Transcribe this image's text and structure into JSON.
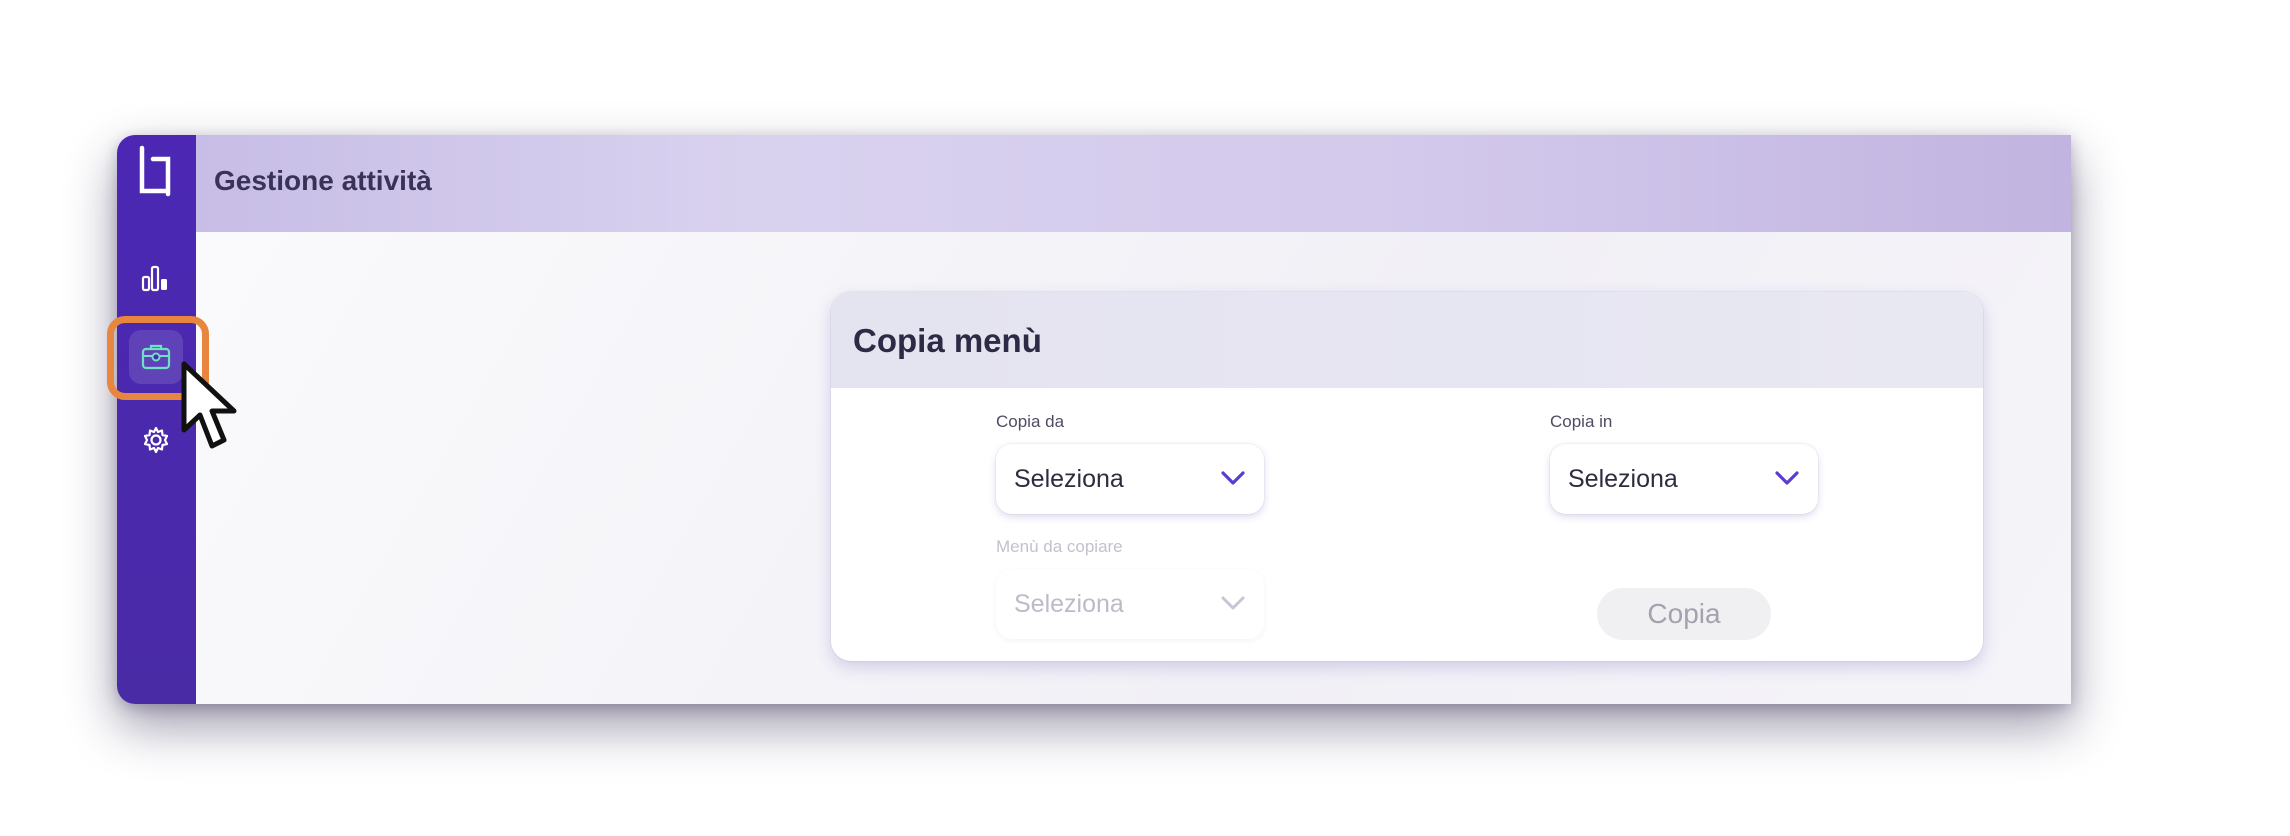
{
  "header": {
    "title": "Gestione attività"
  },
  "sidebar": {
    "items": [
      {
        "icon": "bar-chart-icon",
        "active": false
      },
      {
        "icon": "briefcase-icon",
        "active": true
      },
      {
        "icon": "gear-icon",
        "active": false
      }
    ]
  },
  "card": {
    "title": "Copia menù",
    "fields": {
      "copy_from": {
        "label": "Copia da",
        "value": "Seleziona"
      },
      "copy_to": {
        "label": "Copia in",
        "value": "Seleziona"
      },
      "menu_to_copy": {
        "label": "Menù da copiare",
        "value": "Seleziona",
        "disabled": true
      }
    },
    "button_label": "Copia"
  },
  "colors": {
    "sidebar": "#4b27b4",
    "accent": "#5b3bd0",
    "highlight": "#e8853f",
    "header": "#d3c9ec",
    "icon_active": "#6ee0c4"
  }
}
